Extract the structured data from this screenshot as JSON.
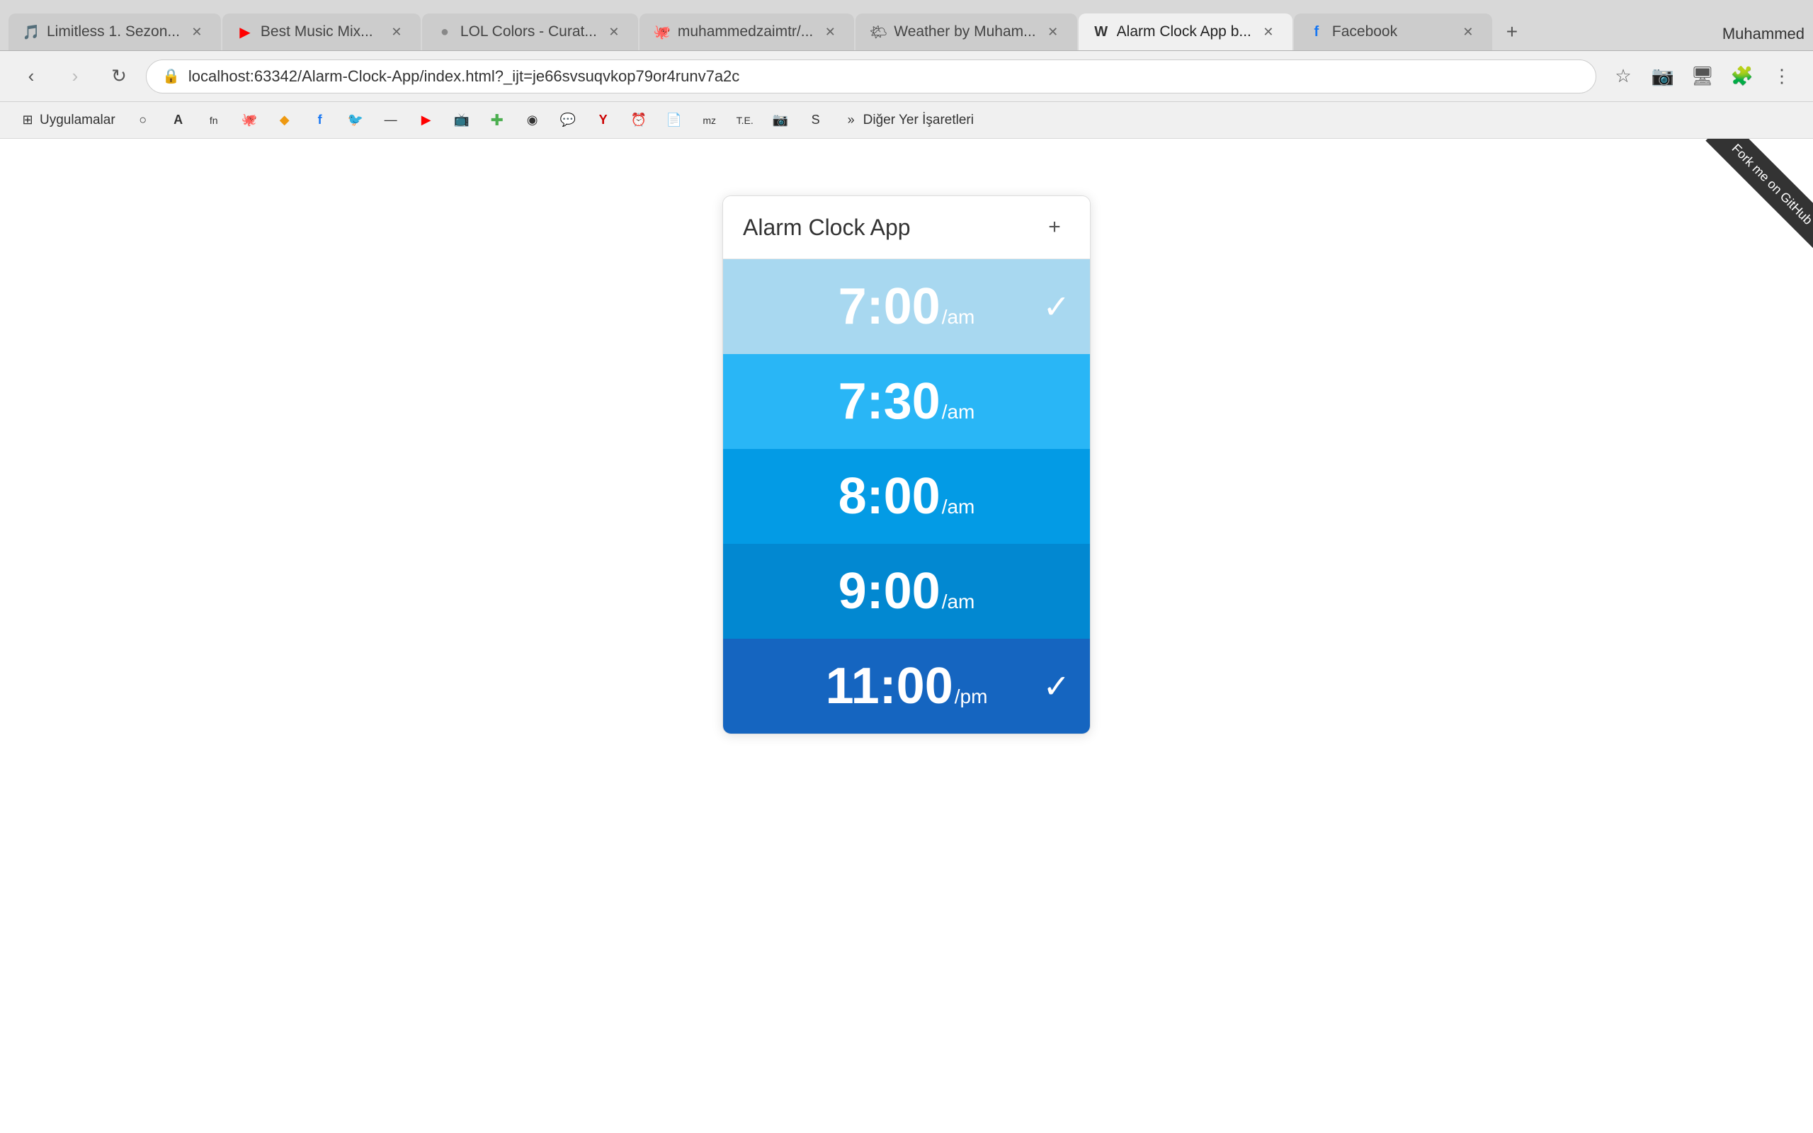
{
  "browser": {
    "tabs": [
      {
        "id": "tab-1",
        "favicon": "🎵",
        "label": "Limitless 1. Sezon...",
        "active": false,
        "closeable": true
      },
      {
        "id": "tab-2",
        "favicon": "▶",
        "label": "Best Music Mix...",
        "active": false,
        "closeable": true
      },
      {
        "id": "tab-3",
        "favicon": "●",
        "label": "LOL Colors - Curat...",
        "active": false,
        "closeable": true
      },
      {
        "id": "tab-4",
        "favicon": "🐙",
        "label": "muhammedzaimtr/...",
        "active": false,
        "closeable": true
      },
      {
        "id": "tab-5",
        "favicon": "🌤",
        "label": "Weather by Muham...",
        "active": false,
        "closeable": true
      },
      {
        "id": "tab-6",
        "favicon": "W",
        "label": "Alarm Clock App b...",
        "active": true,
        "closeable": true
      },
      {
        "id": "tab-7",
        "favicon": "f",
        "label": "Facebook",
        "active": false,
        "closeable": true
      }
    ],
    "profile": "Muhammed",
    "url": "localhost:63342/Alarm-Clock-App/index.html?_ijt=je66svsuqvkop79or4runv7a2c",
    "nav": {
      "back_disabled": false,
      "forward_disabled": true,
      "reload": true
    }
  },
  "bookmarks": [
    {
      "id": "bm-1",
      "favicon": "U",
      "label": "Uygulamalar"
    },
    {
      "id": "bm-2",
      "favicon": "○",
      "label": ""
    },
    {
      "id": "bm-3",
      "favicon": "A",
      "label": ""
    },
    {
      "id": "bm-4",
      "favicon": "fn",
      "label": ""
    },
    {
      "id": "bm-5",
      "favicon": "🐙",
      "label": ""
    },
    {
      "id": "bm-6",
      "favicon": "◆",
      "label": ""
    },
    {
      "id": "bm-7",
      "favicon": "f",
      "label": ""
    },
    {
      "id": "bm-8",
      "favicon": "🐦",
      "label": ""
    },
    {
      "id": "bm-9",
      "favicon": "—",
      "label": ""
    },
    {
      "id": "bm-10",
      "favicon": "▶",
      "label": ""
    },
    {
      "id": "bm-11",
      "favicon": "📺",
      "label": ""
    },
    {
      "id": "bm-12",
      "favicon": "+",
      "label": ""
    },
    {
      "id": "bm-13",
      "favicon": "◉",
      "label": ""
    },
    {
      "id": "bm-14",
      "favicon": "💬",
      "label": ""
    },
    {
      "id": "bm-15",
      "favicon": "Y",
      "label": ""
    },
    {
      "id": "bm-16",
      "favicon": "⏰",
      "label": ""
    },
    {
      "id": "bm-17",
      "favicon": "📄",
      "label": ""
    },
    {
      "id": "bm-18",
      "favicon": "mz",
      "label": ""
    },
    {
      "id": "bm-19",
      "favicon": "T.E.",
      "label": ""
    },
    {
      "id": "bm-20",
      "favicon": "📷",
      "label": ""
    },
    {
      "id": "bm-21",
      "favicon": "S",
      "label": ""
    }
  ],
  "app": {
    "title": "Alarm Clock App",
    "add_button_label": "+",
    "fork_ribbon_line1": "Fork me on GitHub",
    "alarms": [
      {
        "id": "alarm-1",
        "time": "7:00",
        "period": "/am",
        "checked": true,
        "color": "#a8d8f0"
      },
      {
        "id": "alarm-2",
        "time": "7:30",
        "period": "/am",
        "checked": false,
        "color": "#29b6f6"
      },
      {
        "id": "alarm-3",
        "time": "8:00",
        "period": "/am",
        "checked": false,
        "color": "#039be5"
      },
      {
        "id": "alarm-4",
        "time": "9:00",
        "period": "/am",
        "checked": false,
        "color": "#0288d1"
      },
      {
        "id": "alarm-5",
        "time": "11:00",
        "period": "/pm",
        "checked": true,
        "color": "#1565c0"
      }
    ]
  },
  "icons": {
    "back": "‹",
    "forward": "›",
    "reload": "↻",
    "home": "⌂",
    "star": "☆",
    "lock": "🔒",
    "check": "✓",
    "plus": "+"
  }
}
